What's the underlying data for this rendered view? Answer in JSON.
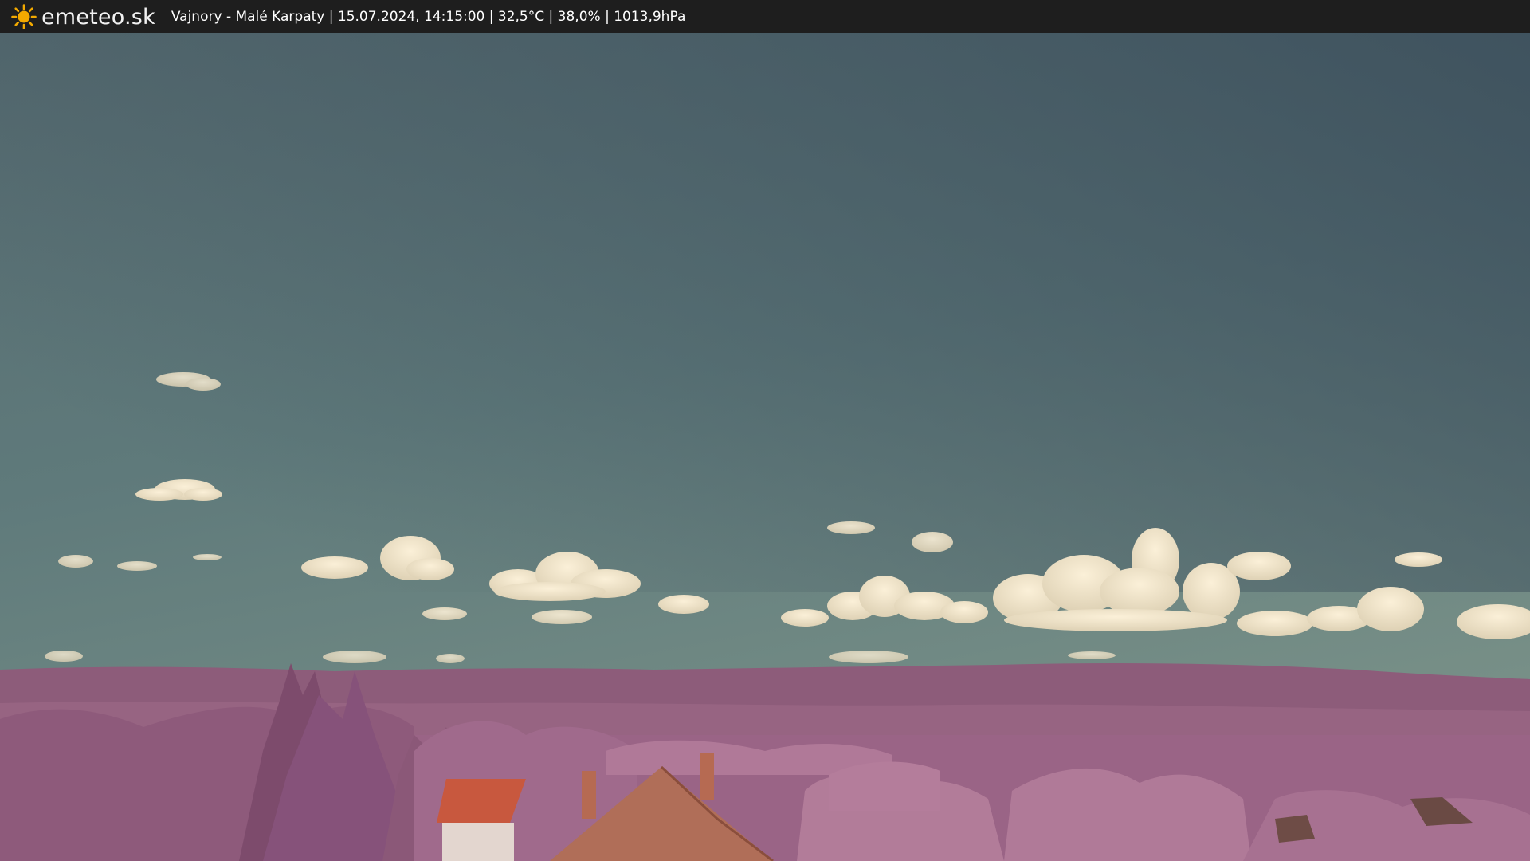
{
  "header": {
    "brand": "emeteo.sk",
    "logo_icon": "sun-icon",
    "caption": "Vajnory - Malé Karpaty | 15.07.2024, 14:15:00 | 32,5°C | 38,0% | 1013,9hPa"
  },
  "colors": {
    "bar": "#1e1e1e",
    "sun": "#f2a900",
    "sky_top": "#3f5462",
    "sky_bottom": "#6f8a85",
    "hills": "#8f5f7c",
    "foliage": "#a8718f",
    "roof": "#c8583e"
  }
}
